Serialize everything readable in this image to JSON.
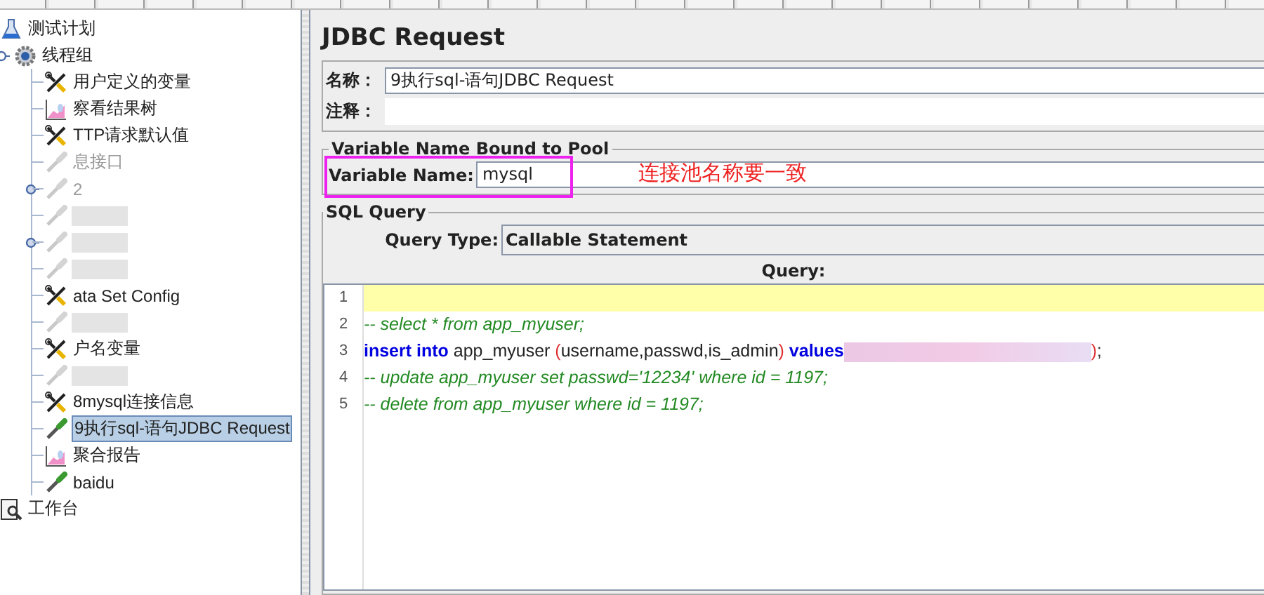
{
  "tree": [
    {
      "label": "测试计划",
      "kind": "flask",
      "children": [
        {
          "label": "线程组",
          "kind": "gear",
          "expanded": true,
          "children": [
            {
              "label": "用户定义的变量",
              "kind": "tools",
              "disabled": false,
              "selected": false
            },
            {
              "label": "察看结果树",
              "kind": "chart",
              "disabled": false,
              "selected": false
            },
            {
              "label": "TTP请求默认值",
              "kind": "tools",
              "disabled": false,
              "selected": false
            },
            {
              "label": "息接口",
              "kind": "dropper",
              "disabled": true,
              "selected": false
            },
            {
              "label": "2",
              "kind": "dropper",
              "disabled": true,
              "selected": false,
              "expanded": false
            },
            {
              "kind": "dropper",
              "disabled": true,
              "selected": false
            },
            {
              "kind": "dropper",
              "disabled": true,
              "selected": false,
              "expanded": false
            },
            {
              "kind": "dropper",
              "disabled": true,
              "selected": false
            },
            {
              "label": "ata Set Config",
              "kind": "tools",
              "disabled": false,
              "selected": false
            },
            {
              "kind": "dropper",
              "disabled": true,
              "selected": false
            },
            {
              "label": "户名变量",
              "kind": "tools",
              "disabled": false,
              "selected": false
            },
            {
              "kind": "dropper",
              "disabled": true,
              "selected": false
            },
            {
              "label": "8mysql连接信息",
              "kind": "tools",
              "disabled": false,
              "selected": false
            },
            {
              "label": "9执行sql-语句JDBC Request",
              "kind": "dropper",
              "disabled": false,
              "selected": true
            },
            {
              "label": "聚合报告",
              "kind": "chart",
              "disabled": false,
              "selected": false
            },
            {
              "label": "baidu",
              "kind": "dropper",
              "disabled": false,
              "selected": false
            }
          ]
        }
      ]
    },
    {
      "label": "工作台",
      "kind": "workbench"
    }
  ],
  "panel": {
    "title": "JDBC Request",
    "name": {
      "label": "名称：",
      "value": "9执行sql-语句JDBC Request"
    },
    "comment": {
      "label": "注释："
    },
    "pool": {
      "legend": "Variable Name Bound to Pool",
      "label": "Variable Name:",
      "value": "mysql",
      "annotation": "连接池名称要一致"
    },
    "sql": {
      "legend": "SQL Query",
      "query_type_label": "Query Type:",
      "query_type": "Callable Statement",
      "query_label": "Query:",
      "lines": [
        {
          "number": "1",
          "current": true
        },
        {
          "number": "2",
          "current": false,
          "tokens": [
            {
              "kind": "comment",
              "text": "-- select * from app_myuser;"
            }
          ]
        },
        {
          "number": "3",
          "current": false,
          "tokens": [
            {
              "kind": "keyword",
              "text": "insert into"
            },
            {
              "kind": "plain",
              "text": " app_myuser "
            },
            {
              "kind": "paren",
              "text": "("
            },
            {
              "kind": "plain",
              "text": "username,passwd,is_admin"
            },
            {
              "kind": "paren",
              "text": ")"
            },
            {
              "kind": "keyword",
              "text": " values"
            },
            {
              "kind": "hidden"
            },
            {
              "kind": "paren",
              "text": ")"
            },
            {
              "kind": "plain",
              "text": ";"
            }
          ]
        },
        {
          "number": "4",
          "current": false,
          "tokens": [
            {
              "kind": "comment",
              "text": "-- update app_myuser set passwd='12234' where id = 1197;"
            }
          ]
        },
        {
          "number": "5",
          "current": false,
          "tokens": [
            {
              "kind": "comment",
              "text": "-- delete from app_myuser where id = 1197;"
            }
          ]
        }
      ]
    }
  }
}
